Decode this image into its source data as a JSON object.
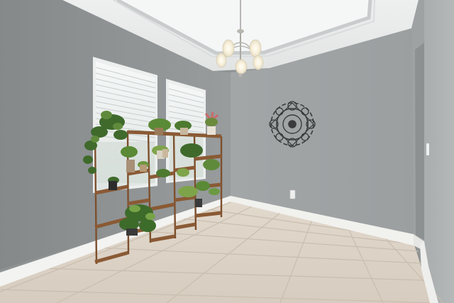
{
  "scene": {
    "kind": "photograph",
    "subject": "empty-dining-room",
    "contains_visible_text": false
  },
  "colors": {
    "left_wall": "#8e9293",
    "back_wall": "#a4a8a9",
    "right_wall": "#aeb2b3",
    "ceiling": "#e9ebeb",
    "tray_ceiling": "#f4f5f5",
    "baseboard": "#f3f3f1",
    "floor_tile": "#dcd2c5",
    "grout": "#c9beaf",
    "window_light": "#eef2f2",
    "plant_stand_wood": "#8a5a35",
    "plant_leaf_dark": "#3f6a2c",
    "plant_leaf_light": "#7ea44a",
    "wall_art_metal": "#3a3b3c",
    "chandelier_metal": "#b7b6b0",
    "bulb_glow": "#fbf6e6"
  },
  "objects": [
    "ceiling-chandelier",
    "window-left-blinds",
    "window-right-blinds",
    "tiered-plant-stand",
    "potted-plants",
    "metal-wall-art-medallion",
    "electrical-outlet",
    "light-switch",
    "tile-floor",
    "baseboard-trim",
    "doorway-opening"
  ]
}
